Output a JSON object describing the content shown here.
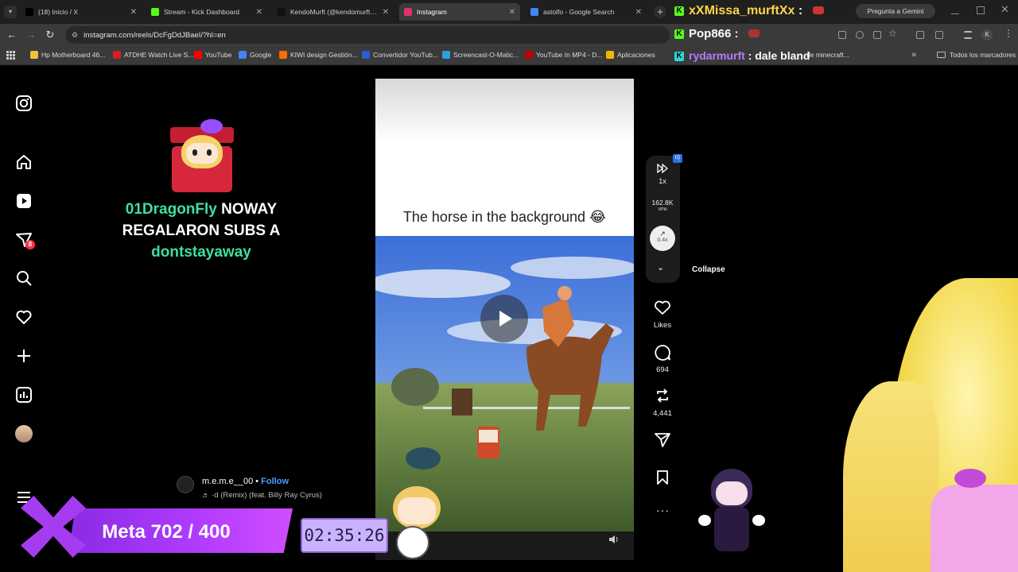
{
  "browser": {
    "tabs": [
      {
        "title": "(18) Inicio / X",
        "favicon_color": "#000000",
        "active": false
      },
      {
        "title": "Stream - Kick Dashboard",
        "favicon_color": "#53fc18",
        "active": false
      },
      {
        "title": "KendoMurft (@kendomurft) | T",
        "favicon_color": "#111111",
        "active": false
      },
      {
        "title": "Instagram",
        "favicon_color": "#e1306c",
        "active": true
      },
      {
        "title": "astolfo - Google Search",
        "favicon_color": "#4285f4",
        "active": false
      }
    ],
    "address": "instagram.com/reels/DcFgDdJBaeI/?hl=en",
    "bookmarks": [
      {
        "label": "Hp Motherboard 46...",
        "color": "#f0c040"
      },
      {
        "label": "ATDHE Watch Live S...",
        "color": "#d02020"
      },
      {
        "label": "YouTube",
        "color": "#ff0000"
      },
      {
        "label": "Google",
        "color": "#4285f4"
      },
      {
        "label": "KIWI design Gestión...",
        "color": "#ff6a00"
      },
      {
        "label": "Convertidor YouTub...",
        "color": "#2d5bd0"
      },
      {
        "label": "Screencast-O-Matic...",
        "color": "#2aa0e0"
      },
      {
        "label": "YouTube In MP4 - D...",
        "color": "#c00000"
      },
      {
        "label": "Aplicaciones",
        "color": "#f4b400"
      }
    ],
    "bookmarks_partial": "de minecraft...",
    "all_bookmarks": "Todos los marcadores",
    "gemini": "Pregunta a Gemini"
  },
  "chat": [
    {
      "user": "xXMissa_murftXx",
      "message": "",
      "user_color": "#ffd54a"
    },
    {
      "user": "Pop866",
      "message": "",
      "user_color": "#ffffff"
    },
    {
      "user": "rydarmurft",
      "message": "dale bland",
      "user_color": "#b57cff"
    }
  ],
  "alert": {
    "user": "01DragonFly",
    "line1": "NOWAY",
    "line2": "REGALARON SUBS A",
    "target": "dontstayaway"
  },
  "reel": {
    "caption": "The horse in the background 😂",
    "author": "m.e.m.e__00",
    "follow": "Follow",
    "audio": "♬  ·d (Remix) (feat. Billy Ray Cyrus)",
    "likes_label": "Likes",
    "comments": "694",
    "reposts": "4,441",
    "speed": "1x",
    "vph_value": "162.8K",
    "vph_label": "VPH",
    "ratio": "0.4x",
    "collapse": "Collapse",
    "iq": "IQ"
  },
  "stream_overlay": {
    "goal": "Meta 702 / 400",
    "goal_letter": "X",
    "timer": "02:35:26"
  },
  "notifications_count": "8"
}
